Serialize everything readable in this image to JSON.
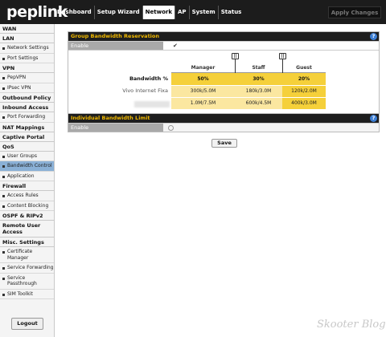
{
  "brand": {
    "logo_text": "peplink"
  },
  "nav": {
    "items": [
      {
        "label": "Dashboard",
        "active": false
      },
      {
        "label": "Setup Wizard",
        "active": false
      },
      {
        "label": "Network",
        "active": true
      },
      {
        "label": "AP",
        "active": false
      },
      {
        "label": "System",
        "active": false
      },
      {
        "label": "Status",
        "active": false
      }
    ],
    "apply_label": "Apply Changes"
  },
  "sidebar": {
    "entries": [
      {
        "kind": "section",
        "label": "WAN"
      },
      {
        "kind": "section",
        "label": "LAN"
      },
      {
        "kind": "item",
        "label": "Network Settings"
      },
      {
        "kind": "item",
        "label": "Port Settings"
      },
      {
        "kind": "section",
        "label": "VPN"
      },
      {
        "kind": "item",
        "label": "PepVPN"
      },
      {
        "kind": "item",
        "label": "IPsec VPN"
      },
      {
        "kind": "section",
        "label": "Outbound Policy"
      },
      {
        "kind": "section",
        "label": "Inbound Access"
      },
      {
        "kind": "item",
        "label": "Port Forwarding"
      },
      {
        "kind": "section",
        "label": "NAT Mappings"
      },
      {
        "kind": "section",
        "label": "Captive Portal"
      },
      {
        "kind": "section",
        "label": "QoS"
      },
      {
        "kind": "item",
        "label": "User Groups"
      },
      {
        "kind": "item",
        "label": "Bandwidth Control",
        "active": true
      },
      {
        "kind": "item",
        "label": "Application"
      },
      {
        "kind": "section",
        "label": "Firewall"
      },
      {
        "kind": "item",
        "label": "Access Rules"
      },
      {
        "kind": "item",
        "label": "Content Blocking"
      },
      {
        "kind": "section",
        "label": "OSPF & RIPv2"
      },
      {
        "kind": "section",
        "label": "Remote User Access"
      },
      {
        "kind": "section",
        "label": "Misc. Settings"
      },
      {
        "kind": "item",
        "label": "Certificate Manager"
      },
      {
        "kind": "item",
        "label": "Service Forwarding"
      },
      {
        "kind": "item",
        "label": "Service Passthrough"
      },
      {
        "kind": "item",
        "label": "SIM Toolkit"
      }
    ],
    "logout_label": "Logout"
  },
  "group_bw": {
    "title": "Group Bandwidth Reservation",
    "help": "?",
    "enable_label": "Enable",
    "enable_checked": true,
    "columns": [
      "Manager",
      "Staff",
      "Guest"
    ],
    "bandwidth_label": "Bandwidth %",
    "percentages": [
      "50%",
      "30%",
      "20%"
    ],
    "rows": [
      {
        "label": "Vivo Internet Fixa",
        "values": [
          "300k/5.0M",
          "180k/3.0M",
          "120k/2.0M"
        ]
      },
      {
        "label": "",
        "values": [
          "1.0M/7.5M",
          "600k/4.5M",
          "400k/3.0M"
        ]
      }
    ]
  },
  "individual_bw": {
    "title": "Individual Bandwidth Limit",
    "help": "?",
    "enable_label": "Enable",
    "enable_checked": false
  },
  "save_label": "Save",
  "watermark": "Skooter Blog"
}
